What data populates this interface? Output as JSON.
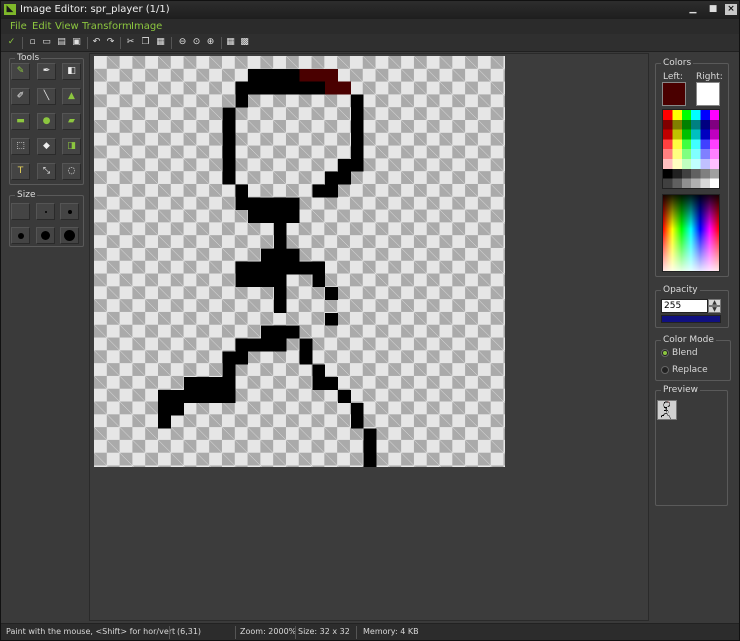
{
  "window": {
    "title": "Image Editor: spr_player (1/1)"
  },
  "menu": {
    "items": [
      "File",
      "Edit",
      "View",
      "Transform",
      "Image"
    ]
  },
  "toolbar": {
    "icons": [
      "confirm-icon",
      "new-icon",
      "open-icon",
      "import-icon",
      "save-icon",
      "undo-icon",
      "redo-icon",
      "cut-icon",
      "copy-icon",
      "paste-icon",
      "zoom-out-icon",
      "zoom-reset-icon",
      "zoom-in-icon",
      "grid-icon",
      "toggle-grid-icon"
    ]
  },
  "tools_panel": {
    "label": "Tools",
    "tools": [
      "pencil",
      "spray",
      "eraser",
      "color-picker",
      "line",
      "polygon",
      "rectangle",
      "ellipse",
      "rounded-rectangle",
      "select-rectangle",
      "fill",
      "select-region",
      "text",
      "change-color",
      "magic-wand"
    ]
  },
  "size_panel": {
    "label": "Size"
  },
  "colors_panel": {
    "label": "Colors",
    "left_label": "Left:",
    "right_label": "Right:",
    "left_color": "#4a0000",
    "right_color": "#ffffff"
  },
  "opacity_panel": {
    "label": "Opacity",
    "value": "255"
  },
  "color_mode_panel": {
    "label": "Color Mode",
    "options": [
      "Blend",
      "Replace"
    ],
    "selected": "Blend"
  },
  "preview_panel": {
    "label": "Preview"
  },
  "status": {
    "hint": "Paint with the mouse, <Shift> for hor/vert",
    "position": "(6,31)",
    "zoom": "Zoom: 2000%",
    "size": "Size: 32 x 32",
    "memory": "Memory: 4 KB"
  },
  "sprite": {
    "width": 32,
    "height": 32,
    "black_runs": [
      [
        1,
        12,
        16
      ],
      [
        2,
        11,
        19
      ],
      [
        3,
        11,
        11
      ],
      [
        3,
        20,
        20
      ],
      [
        4,
        10,
        10
      ],
      [
        4,
        20,
        20
      ],
      [
        5,
        10,
        10
      ],
      [
        5,
        20,
        20
      ],
      [
        6,
        10,
        10
      ],
      [
        6,
        20,
        20
      ],
      [
        7,
        10,
        10
      ],
      [
        7,
        20,
        20
      ],
      [
        8,
        10,
        10
      ],
      [
        8,
        19,
        20
      ],
      [
        9,
        10,
        10
      ],
      [
        9,
        18,
        19
      ],
      [
        10,
        11,
        11
      ],
      [
        10,
        17,
        18
      ],
      [
        11,
        11,
        15
      ],
      [
        12,
        12,
        15
      ],
      [
        13,
        14,
        14
      ],
      [
        14,
        14,
        14
      ],
      [
        15,
        13,
        15
      ],
      [
        16,
        11,
        17
      ],
      [
        17,
        11,
        13
      ],
      [
        17,
        14,
        14
      ],
      [
        17,
        17,
        17
      ],
      [
        18,
        14,
        14
      ],
      [
        18,
        18,
        18
      ],
      [
        19,
        14,
        14
      ],
      [
        20,
        18,
        18
      ],
      [
        21,
        13,
        15
      ],
      [
        22,
        11,
        14
      ],
      [
        22,
        16,
        16
      ],
      [
        23,
        10,
        11
      ],
      [
        23,
        16,
        16
      ],
      [
        24,
        10,
        10
      ],
      [
        24,
        17,
        17
      ],
      [
        25,
        7,
        10
      ],
      [
        25,
        17,
        18
      ],
      [
        26,
        5,
        10
      ],
      [
        26,
        19,
        19
      ],
      [
        27,
        5,
        6
      ],
      [
        27,
        20,
        20
      ],
      [
        28,
        5,
        5
      ],
      [
        28,
        20,
        20
      ],
      [
        29,
        21,
        21
      ],
      [
        30,
        21,
        21
      ],
      [
        31,
        21,
        21
      ]
    ],
    "dark_red_runs": [
      [
        1,
        16,
        18
      ],
      [
        2,
        18,
        19
      ]
    ]
  }
}
